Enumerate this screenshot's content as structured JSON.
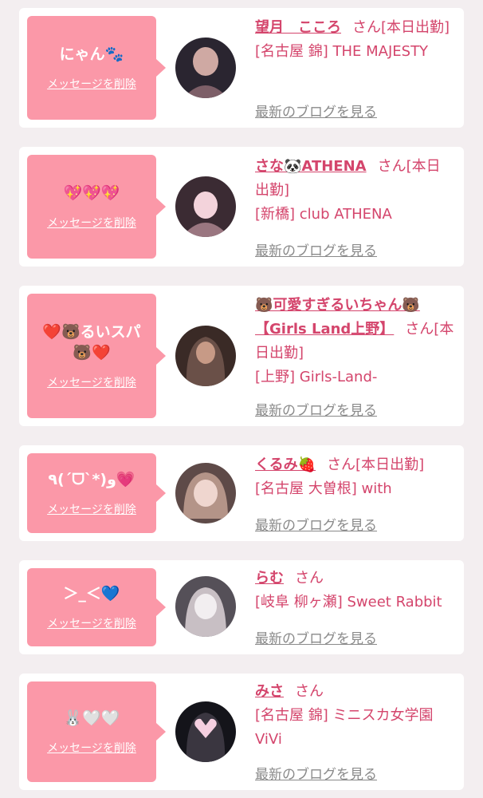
{
  "messages": [
    {
      "message": "にゃん🐾",
      "delete_label": "メッセージを削除",
      "name": "望月　こころ",
      "suffix": "さん[本日出勤]",
      "shop": "[名古屋 錦] THE MAJESTY",
      "blog_label": "最新のブログを見る",
      "avatar_colors": [
        "#2a2530",
        "#7d5f68",
        "#cfa9a3"
      ]
    },
    {
      "message": "💖💖💖",
      "delete_label": "メッセージを削除",
      "name": "さな🐼ATHENA",
      "suffix": "さん[本日出勤]",
      "shop": "[新橋] club ATHENA",
      "blog_label": "最新のブログを見る",
      "avatar_colors": [
        "#3b2b33",
        "#9a7680",
        "#f3d3db"
      ]
    },
    {
      "message": "❤️🐻るいスパ🐻❤️",
      "delete_label": "メッセージを削除",
      "name": "🐻可愛すぎるいちゃん🐻【Girls Land上野】",
      "suffix": "さん[本日出勤]",
      "shop": "[上野] Girls-Land-",
      "blog_label": "最新のブログを見る",
      "avatar_colors": [
        "#3a2a26",
        "#6a5048",
        "#c79a86"
      ]
    },
    {
      "message": "٩(ˊᗜˋ*)و💗",
      "delete_label": "メッセージを削除",
      "name": "くるみ🍓",
      "suffix": "さん[本日出勤]",
      "shop": "[名古屋 大曽根] with",
      "blog_label": "最新のブログを見る",
      "avatar_colors": [
        "#5e4a48",
        "#b49488",
        "#efd6cf"
      ]
    },
    {
      "message": "＞_＜💙",
      "delete_label": "メッセージを削除",
      "name": "らむ",
      "suffix": "さん",
      "shop": "[岐阜 柳ヶ瀬] Sweet Rabbit",
      "blog_label": "最新のブログを見る",
      "avatar_colors": [
        "#555058",
        "#c8bfc4",
        "#f2eef0"
      ]
    },
    {
      "message": "🐰🤍🤍",
      "delete_label": "メッセージを削除",
      "name": "みさ",
      "suffix": "さん",
      "shop": "[名古屋 錦] ミニスカ女学園ViVi",
      "blog_label": "最新のブログを見る",
      "avatar_colors": [
        "#14141a",
        "#3a3640",
        "#f5cfe0"
      ]
    }
  ]
}
